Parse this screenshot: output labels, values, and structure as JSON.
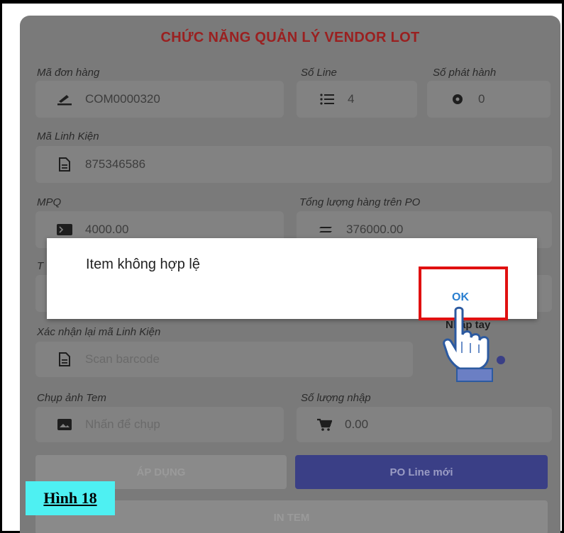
{
  "screen": {
    "title": "CHỨC NĂNG QUẢN LÝ VENDOR LOT",
    "ma_don_hang": {
      "label": "Mã đơn hàng",
      "value": "COM0000320",
      "icon": "edit-icon"
    },
    "so_line": {
      "label": "Số Line",
      "value": "4",
      "icon": "list-icon"
    },
    "so_phat_hanh": {
      "label": "Số phát hành",
      "value": "0",
      "icon": "gear-icon"
    },
    "ma_linh_kien": {
      "label": "Mã Linh Kiện",
      "value": "875346586",
      "icon": "document-icon"
    },
    "mpq": {
      "label": "MPQ",
      "value": "4000.00",
      "icon": "terminal-icon"
    },
    "tong_luong": {
      "label": "Tổng lượng hàng trên PO",
      "value": "376000.00",
      "icon": "equals-icon"
    },
    "hidden_label_fragment": "T",
    "nhap_tay": "Nhập tay",
    "xac_nhan": {
      "label": "Xác nhận lại mã Linh Kiện",
      "placeholder": "Scan barcode",
      "icon": "document-icon"
    },
    "chup_anh": {
      "label": "Chụp ảnh Tem",
      "placeholder": "Nhấn để chụp",
      "icon": "image-icon"
    },
    "so_luong_nhap": {
      "label": "Số lượng nhập",
      "value": "0.00",
      "icon": "cart-icon"
    },
    "buttons": {
      "ap_dung": "ÁP DỤNG",
      "po_line_moi": "PO Line mới",
      "in_tem": "IN TEM"
    }
  },
  "dialog": {
    "message": "Item không hợp lệ",
    "ok_label": "OK"
  },
  "caption": "Hình 18",
  "colors": {
    "title": "#9a2020",
    "ok": "#2a7fd0",
    "highlight": "#e01010",
    "caption_bg": "#4ef0f2",
    "po_button": "#3a3f86"
  }
}
